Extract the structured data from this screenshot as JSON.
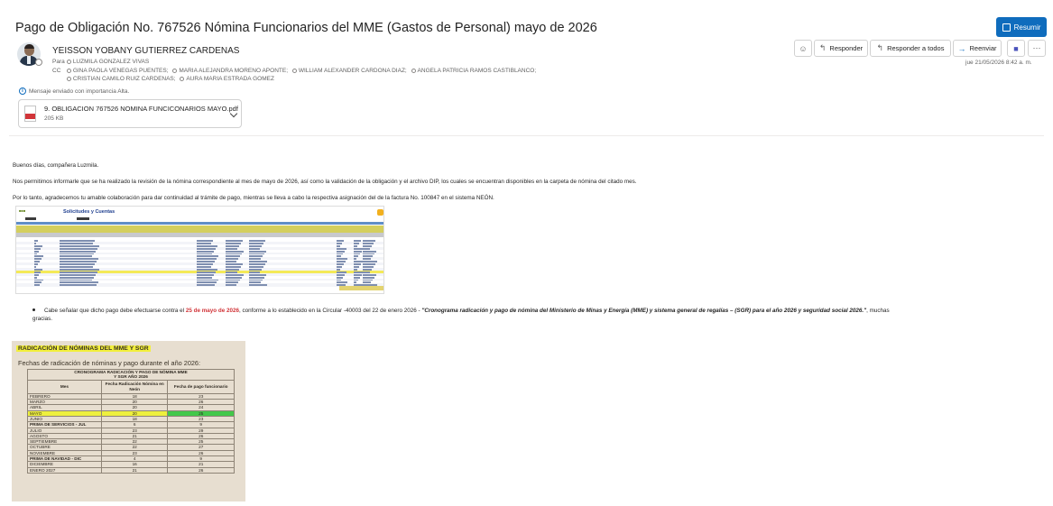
{
  "email": {
    "subject": "Pago de Obligación No. 767526 Nómina Funcionarios del MME (Gastos de Personal) mayo de 2026",
    "summarize_label": "Resumir",
    "sender": "YEISSON YOBANY GUTIERREZ CARDENAS",
    "to_label": "Para",
    "to": [
      "LUZMILA GONZALEZ VIVAS"
    ],
    "cc_label": "CC",
    "cc_line1": [
      "GINA PAOLA VENEGAS PUENTES;",
      "MARIA ALEJANDRA MORENO APONTE;",
      "WILLIAM ALEXANDER CARDONA DIAZ;",
      "ANGELA PATRICIA RAMOS CASTIBLANCO;"
    ],
    "cc_line2": [
      "CRISTIAN CAMILO RUIZ CARDENAS;",
      "AURA MARIA ESTRADA GOMEZ"
    ],
    "importance": "Mensaje enviado con importancia Alta.",
    "attachment": {
      "name": "9. OBLIGACION 767526 NOMINA FUNCICONARIOS MAYO.pdf",
      "size": "205 KB"
    },
    "actions": {
      "reply": "Responder",
      "reply_all": "Responder a todos",
      "forward": "Reenviar"
    },
    "date": "jue 21/05/2026 8:42 a. m."
  },
  "body": {
    "greeting": "Buenos días, compañera Luzmila.",
    "para1": "Nos permitimos informarle que se ha realizado la revisión de la nómina correspondiente al mes de mayo de 2026, así como la validación de la obligación y el archivo DIP, los cuales se encuentran disponibles en la carpeta de nómina del citado mes.",
    "para2": "Por lo tanto, agradecemos tu amable colaboración para dar continuidad al trámite de pago, mientras se lleva a cabo la respectiva asignación del de la factura No. 100847 en el sistema NEÓN.",
    "screenshot_title": "Solicitudes y Cuentas",
    "bullet_pre": "Cabe señalar que dicho pago debe efectuarse contra el ",
    "bullet_date": "25 de mayo de 2026",
    "bullet_mid": ", conforme a lo establecido en la Circular -40003 del 22 de enero 2026 - ",
    "bullet_quote": "\"Cronograma radicación y pago de nómina del Ministerio de Minas y Energía (MME) y sistema general de regalías – (SGR) para el año 2026 y seguridad social 2026.\"",
    "bullet_post": ", muchas gracias."
  },
  "schedule": {
    "title": "RADICACIÓN DE NÓMINAS DEL MME Y SGR",
    "subtitle": "Fechas de radicación de nóminas y pago durante el año 2026:",
    "table_title_1": "CRONOGRAMA RADICACIÓN Y PAGO DE NÓMINA MME",
    "table_title_2": "Y SGR AÑO 2026",
    "col_month": "Mes",
    "col_filing": "Fecha Radicación Nómina en Neón",
    "col_payment": "Fecha de pago funcionario",
    "rows": [
      {
        "month": "FEBRERO",
        "filing": "18",
        "payment": "23"
      },
      {
        "month": "MARZO",
        "filing": "20",
        "payment": "26"
      },
      {
        "month": "ABRIL",
        "filing": "20",
        "payment": "24"
      },
      {
        "month": "MAYO",
        "filing": "20",
        "payment": "25"
      },
      {
        "month": "JUNIO",
        "filing": "18",
        "payment": "23"
      },
      {
        "month": "PRIMA DE SERVICIOS - JUL",
        "filing": "6",
        "payment": "9"
      },
      {
        "month": "JULIO",
        "filing": "23",
        "payment": "29"
      },
      {
        "month": "AGOSTO",
        "filing": "21",
        "payment": "26"
      },
      {
        "month": "SEPTIEMBRE",
        "filing": "22",
        "payment": "25"
      },
      {
        "month": "OCTUBRE",
        "filing": "22",
        "payment": "27"
      },
      {
        "month": "NOVIEMBRE",
        "filing": "23",
        "payment": "26"
      },
      {
        "month": "PRIMA DE NAVIDAD - DIC",
        "filing": "4",
        "payment": "9"
      },
      {
        "month": "DICIEMBRE",
        "filing": "16",
        "payment": "21"
      },
      {
        "month": "ENERO 2027",
        "filing": "21",
        "payment": "26"
      }
    ]
  },
  "colors": {
    "accent": "#0f6cbd",
    "highlight_yellow": "#eef03d",
    "highlight_green": "#43c84a",
    "date_red": "#d13438"
  }
}
